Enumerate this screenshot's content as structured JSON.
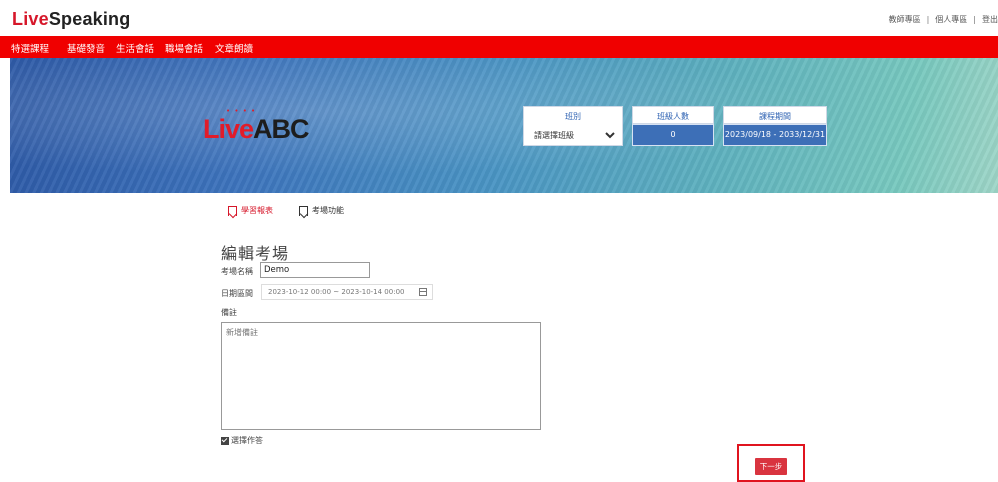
{
  "header": {
    "brand_prefix": "Live",
    "brand_suffix": "Speaking",
    "links": [
      "教師專區",
      "個人專區",
      "登出"
    ],
    "separator": "|"
  },
  "nav": {
    "items": [
      "特選課程",
      "基礎發音",
      "生活會話",
      "職場會話",
      "文章朗讀"
    ],
    "color": "#f00000"
  },
  "banner": {
    "logo_red": "Live",
    "logo_black": "ABC",
    "class_label": "班別",
    "class_select_value": "請選擇班級",
    "students_label": "班級人數",
    "students_value": "0",
    "period_label": "課程期間",
    "period_value": "2023/09/18 - 2033/12/31"
  },
  "tabs": [
    {
      "label": "學習報表",
      "active": true,
      "icon": "bookmark-icon"
    },
    {
      "label": "考場功能",
      "active": false,
      "icon": "bookmark-icon"
    }
  ],
  "form": {
    "title": "編輯考場",
    "name_label": "考場名稱",
    "name_value": "Demo",
    "date_label": "日期區間",
    "date_value": "2023-10-12 00:00 ~ 2023-10-14 00:00",
    "note_label": "備註",
    "note_placeholder": "新增備註",
    "checkbox_label": "選擇作答",
    "checkbox_checked": true,
    "next_label": "下一步",
    "accent_color": "#d9343f"
  }
}
